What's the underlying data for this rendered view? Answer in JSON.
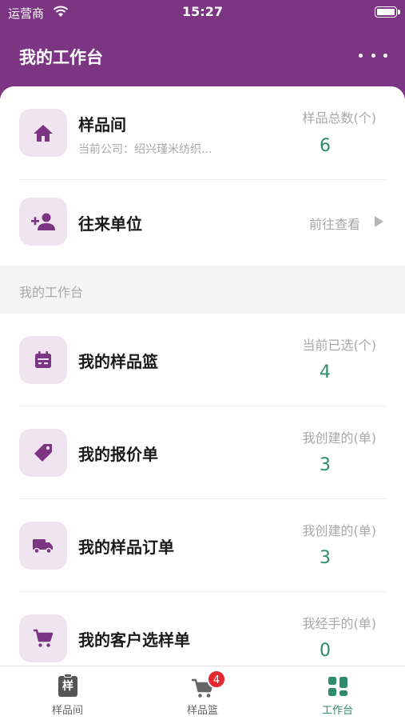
{
  "status_bar": {
    "carrier": "运营商",
    "time": "15:27"
  },
  "header": {
    "title": "我的工作台"
  },
  "sample_room": {
    "title": "样品间",
    "subtitle": "当前公司：绍兴瑾米纺织...",
    "stat_label": "样品总数(个)",
    "stat_value": "6",
    "icon": "home-icon"
  },
  "contacts": {
    "title": "往来单位",
    "link_text": "前往查看",
    "icon": "add-person-icon"
  },
  "section": {
    "title": "我的工作台"
  },
  "items": [
    {
      "title": "我的样品篮",
      "stat_label": "当前已选(个)",
      "stat_value": "4",
      "icon": "calendar-icon"
    },
    {
      "title": "我的报价单",
      "stat_label": "我创建的(单)",
      "stat_value": "3",
      "icon": "tag-icon"
    },
    {
      "title": "我的样品订单",
      "stat_label": "我创建的(单)",
      "stat_value": "3",
      "icon": "truck-icon"
    },
    {
      "title": "我的客户选样单",
      "stat_label": "我经手的(单)",
      "stat_value": "0",
      "icon": "cart-icon"
    }
  ],
  "tabbar": {
    "tabs": [
      {
        "label": "样品间",
        "icon_text": "样",
        "icon": "sample-icon"
      },
      {
        "label": "样品篮",
        "badge": "4",
        "icon": "cart-icon"
      },
      {
        "label": "工作台",
        "icon": "dashboard-icon",
        "active": true
      }
    ]
  },
  "colors": {
    "brand": "#7b3582",
    "accent_green": "#2e8b6c",
    "icon_bg": "#efe4f0",
    "badge": "#e4282f"
  }
}
